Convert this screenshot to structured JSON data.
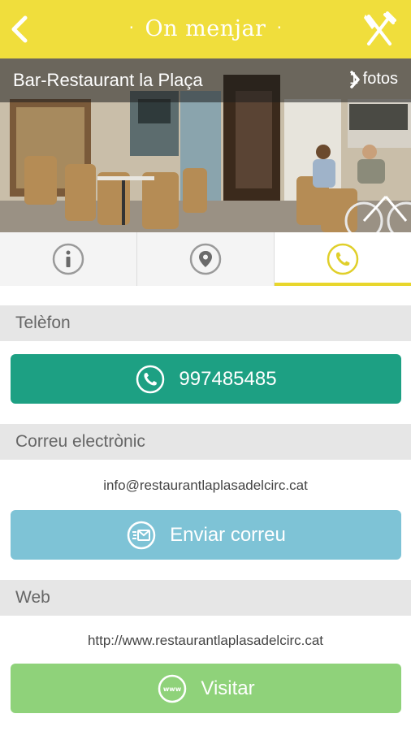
{
  "header": {
    "title": "On menjar",
    "title_dot": "·",
    "back_icon": "chevron-left-icon",
    "menu_icon": "fork-knife-icon"
  },
  "hero": {
    "restaurant_name": "Bar-Restaurant la Plaça",
    "photos_label": "1 fotos"
  },
  "tabs": [
    {
      "icon": "info-icon",
      "active": false
    },
    {
      "icon": "location-pin-icon",
      "active": false
    },
    {
      "icon": "phone-icon",
      "active": true
    }
  ],
  "phone": {
    "section_label": "Telèfon",
    "number": "997485485"
  },
  "email": {
    "section_label": "Correu electrònic",
    "address": "info@restaurantlaplasadelcirc.cat",
    "button_label": "Enviar correu"
  },
  "web": {
    "section_label": "Web",
    "url": "http://www.restaurantlaplasadelcirc.cat",
    "button_label": "Visitar",
    "icon_text": "www"
  },
  "colors": {
    "header": "#f0de3c",
    "phone_button": "#1da083",
    "mail_button": "#7ec3d6",
    "web_button": "#8fd27a",
    "active_tab_accent": "#e8d62c"
  }
}
